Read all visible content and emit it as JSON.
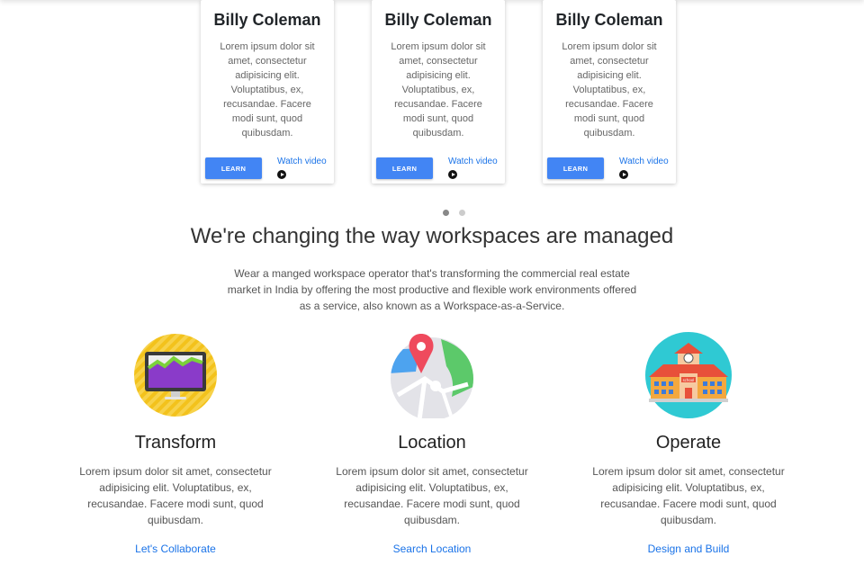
{
  "cards": [
    {
      "name": "Billy Coleman",
      "text": "Lorem ipsum dolor sit amet, consectetur adipisicing elit. Voluptatibus, ex, recusandae. Facere modi sunt, quod quibusdam.",
      "button_label": "LEARN",
      "link_label": "Watch video"
    },
    {
      "name": "Billy Coleman",
      "text": "Lorem ipsum dolor sit amet, consectetur adipisicing elit. Voluptatibus, ex, recusandae. Facere modi sunt, quod quibusdam.",
      "button_label": "LEARN",
      "link_label": "Watch video"
    },
    {
      "name": "Billy Coleman",
      "text": "Lorem ipsum dolor sit amet, consectetur adipisicing elit. Voluptatibus, ex, recusandae. Facere modi sunt, quod quibusdam.",
      "button_label": "LEARN",
      "link_label": "Watch video"
    }
  ],
  "carousel": {
    "active_index": 0,
    "count": 2
  },
  "section": {
    "headline": "We're changing the way workspaces are managed",
    "intro": "Wear a manged workspace operator that's transforming the commercial real estate market in India by offering the most productive and flexible work environments offered as a service, also known as a Workspace-as-a-Service."
  },
  "features": [
    {
      "icon": "monitor-chart-icon",
      "title": "Transform",
      "text": "Lorem ipsum dolor sit amet, consectetur adipisicing elit. Voluptatibus, ex, recusandae. Facere modi sunt, quod quibusdam.",
      "link": "Let's Collaborate"
    },
    {
      "icon": "map-pin-icon",
      "title": "Location",
      "text": "Lorem ipsum dolor sit amet, consectetur adipisicing elit. Voluptatibus, ex, recusandae. Facere modi sunt, quod quibusdam.",
      "link": "Search Location"
    },
    {
      "icon": "school-building-icon",
      "title": "Operate",
      "text": "Lorem ipsum dolor sit amet, consectetur adipisicing elit. Voluptatibus, ex, recusandae. Facere modi sunt, quod quibusdam.",
      "link": "Design and Build",
      "icon_sign_text": "school"
    }
  ],
  "colors": {
    "accent": "#4285f4",
    "link": "#1a73e8",
    "transform_bg": "#f5c518",
    "operate_bg": "#2fc9d3"
  }
}
